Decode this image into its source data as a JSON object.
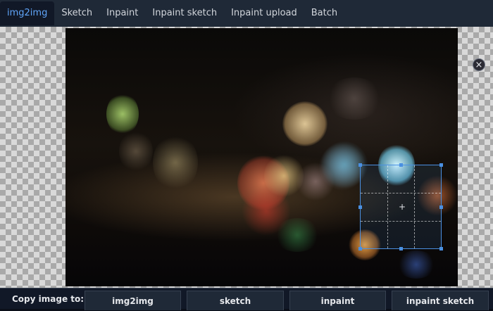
{
  "tabs": [
    {
      "label": "img2img",
      "active": true
    },
    {
      "label": "Sketch",
      "active": false
    },
    {
      "label": "Inpaint",
      "active": false
    },
    {
      "label": "Inpaint sketch",
      "active": false
    },
    {
      "label": "Inpaint upload",
      "active": false
    },
    {
      "label": "Batch",
      "active": false
    }
  ],
  "canvas": {
    "close_symbol": "×",
    "crop_center_symbol": "+"
  },
  "copy_bar": {
    "label": "Copy image to:",
    "buttons": [
      "img2img",
      "sketch",
      "inpaint",
      "inpaint sketch"
    ]
  },
  "colors": {
    "active_tab": "#60a5fa",
    "crop_box": "#4a90e2"
  }
}
